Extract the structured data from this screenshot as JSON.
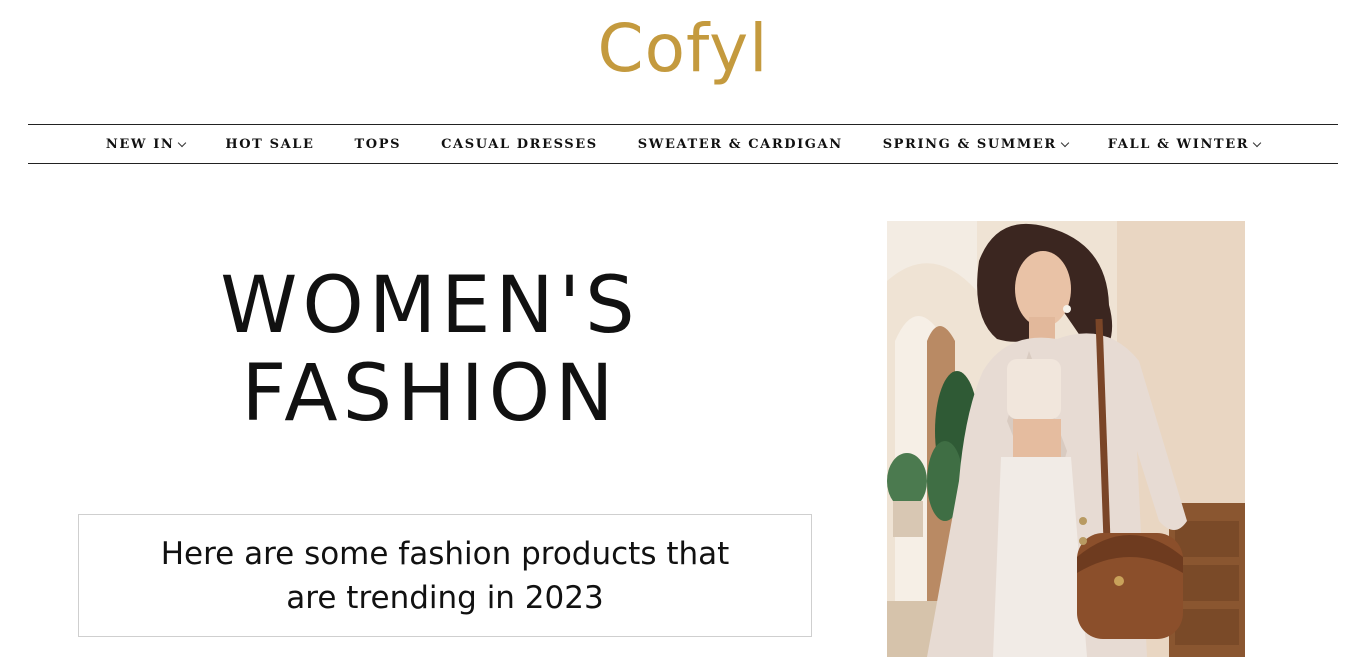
{
  "header": {
    "logo_text": "Cofyl"
  },
  "nav": {
    "items": [
      {
        "label": "NEW IN",
        "has_dropdown": true
      },
      {
        "label": "HOT SALE",
        "has_dropdown": false
      },
      {
        "label": "TOPS",
        "has_dropdown": false
      },
      {
        "label": "CASUAL DRESSES",
        "has_dropdown": false
      },
      {
        "label": "SWEATER & CARDIGAN",
        "has_dropdown": false
      },
      {
        "label": "SPRING & SUMMER",
        "has_dropdown": true
      },
      {
        "label": "FALL & WINTER",
        "has_dropdown": true
      }
    ]
  },
  "hero": {
    "title_line1": "WOMEN'S",
    "title_line2": "FASHION",
    "subtitle": "Here are some fashion products that are trending in 2023"
  },
  "colors": {
    "logo": "#c49a3e",
    "text": "#111111",
    "border": "#cfcfcf"
  }
}
